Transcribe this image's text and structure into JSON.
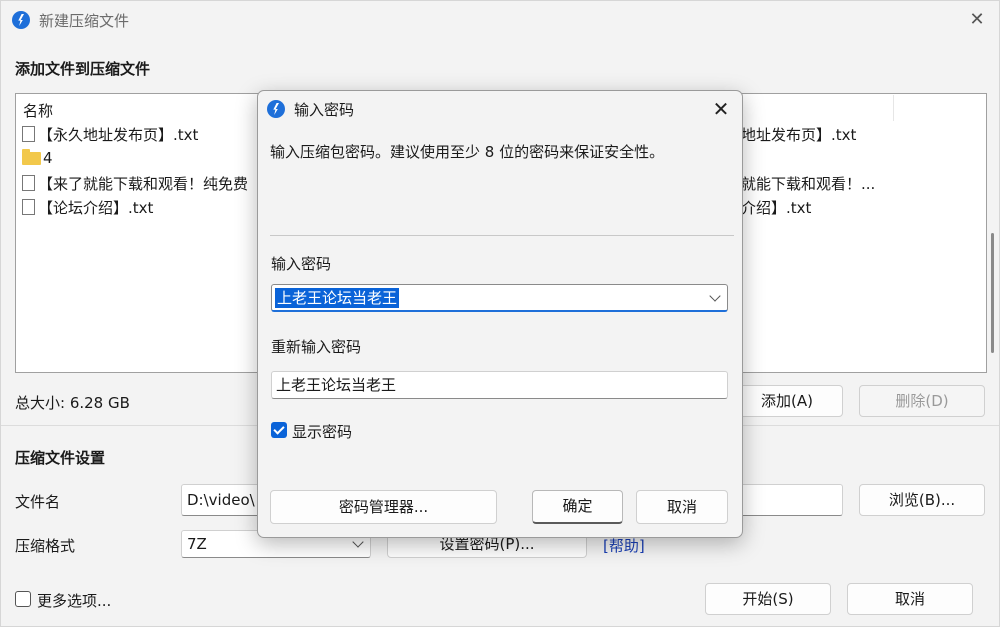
{
  "window": {
    "title": "新建压缩文件",
    "close_glyph": "✕"
  },
  "files_section": {
    "title": "添加文件到压缩文件",
    "column_name": "名称",
    "rows": [
      {
        "type": "file",
        "name": "【永久地址发布页】.txt"
      },
      {
        "type": "folder",
        "name": "4"
      },
      {
        "type": "file",
        "name": "【来了就能下载和观看！纯免费"
      },
      {
        "type": "file",
        "name": "【论坛介绍】.txt"
      }
    ],
    "right_column_rows": [
      "地址发布页】.txt",
      "",
      "就能下载和观看！...",
      "介绍】.txt"
    ]
  },
  "total_size_label": "总大小: 6.28 GB",
  "add_button": "添加(A)",
  "delete_button": "删除(D)",
  "settings_section": {
    "title": "压缩文件设置",
    "filename_label": "文件名",
    "filename_value": "D:\\video\\",
    "browse_button": "浏览(B)...",
    "format_label": "压缩格式",
    "format_value": "7Z",
    "set_password_button": "设置密码(P)...",
    "help_link": "[帮助]"
  },
  "more_options_label": "更多选项...",
  "start_button": "开始(S)",
  "cancel_button": "取消",
  "dialog": {
    "title": "输入密码",
    "close_glyph": "✕",
    "description": "输入压缩包密码。建议使用至少 8 位的密码来保证安全性。",
    "password_label": "输入密码",
    "password_value": "上老王论坛当老王",
    "reenter_label": "重新输入密码",
    "reenter_value": "上老王论坛当老王",
    "show_password_label": "显示密码",
    "show_password_checked": true,
    "manager_button": "密码管理器...",
    "ok_button": "确定",
    "cancel_button": "取消"
  },
  "colors": {
    "accent": "#0a63d8",
    "folder": "#f2c84b",
    "link": "#1a3fb5"
  }
}
